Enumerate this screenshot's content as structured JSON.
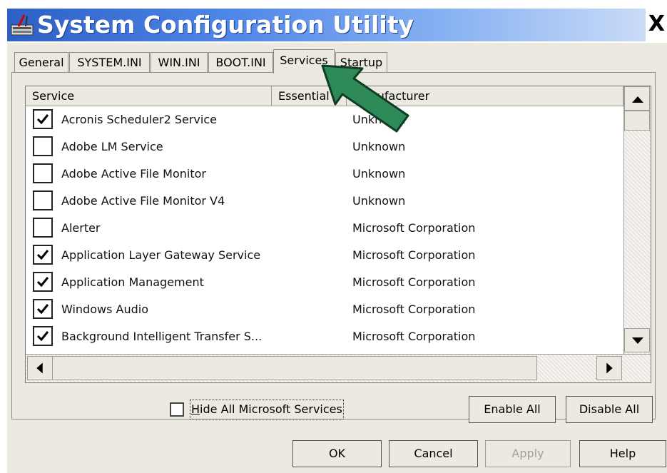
{
  "window": {
    "title": "System Configuration Utility",
    "close_glyph": "X",
    "icon": "msconfig-app-icon"
  },
  "tabs": [
    {
      "label": "General",
      "active": false
    },
    {
      "label": "SYSTEM.INI",
      "active": false
    },
    {
      "label": "WIN.INI",
      "active": false
    },
    {
      "label": "BOOT.INI",
      "active": false
    },
    {
      "label": "Services",
      "active": true
    },
    {
      "label": "Startup",
      "active": false
    }
  ],
  "services_table": {
    "columns": [
      "Service",
      "Essential",
      "Manufacturer"
    ],
    "rows": [
      {
        "name": "Acronis Scheduler2 Service",
        "manufacturer": "Unknown",
        "checked": true
      },
      {
        "name": "Adobe LM Service",
        "manufacturer": "Unknown",
        "checked": false
      },
      {
        "name": "Adobe Active File Monitor",
        "manufacturer": "Unknown",
        "checked": false
      },
      {
        "name": "Adobe Active File Monitor V4",
        "manufacturer": "Unknown",
        "checked": false
      },
      {
        "name": "Alerter",
        "manufacturer": "Microsoft Corporation",
        "checked": false
      },
      {
        "name": "Application Layer Gateway Service",
        "manufacturer": "Microsoft Corporation",
        "checked": true
      },
      {
        "name": "Application Management",
        "manufacturer": "Microsoft Corporation",
        "checked": true
      },
      {
        "name": "Windows Audio",
        "manufacturer": "Microsoft Corporation",
        "checked": true
      },
      {
        "name": "Background Intelligent Transfer S...",
        "manufacturer": "Microsoft Corporation",
        "checked": true
      }
    ]
  },
  "hide_ms_services": {
    "label": "Hide All Microsoft Services",
    "checked": false
  },
  "buttons": {
    "enable_all": "Enable All",
    "disable_all": "Disable All",
    "ok": "OK",
    "cancel": "Cancel",
    "apply": "Apply",
    "help": "Help"
  },
  "colors": {
    "title_gradient_start": "#2d5fc4",
    "dialog_bg": "#ece9e0",
    "arrow_fill": "#2e8b57"
  }
}
